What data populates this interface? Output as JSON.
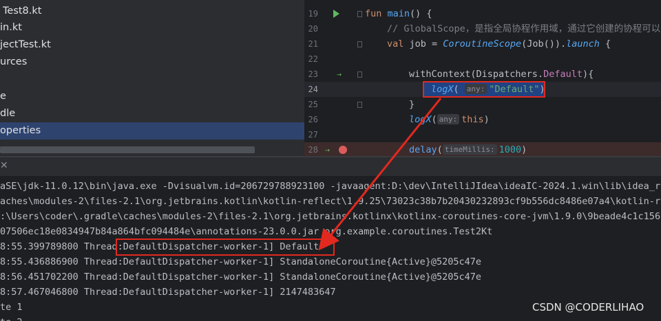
{
  "project_tree": {
    "items": [
      {
        "label": "Test8.kt",
        "selected": false
      },
      {
        "label": "in.kt",
        "selected": false
      },
      {
        "label": "jectTest.kt",
        "selected": false
      },
      {
        "label": "urces",
        "selected": false
      },
      {
        "label": "e",
        "selected": false
      },
      {
        "label": "dle",
        "selected": false
      },
      {
        "label": "operties",
        "selected": true
      }
    ]
  },
  "editor": {
    "lines": [
      {
        "num": "19"
      },
      {
        "num": "20"
      },
      {
        "num": "21"
      },
      {
        "num": "22"
      },
      {
        "num": "23"
      },
      {
        "num": "24"
      },
      {
        "num": "25"
      },
      {
        "num": "26"
      },
      {
        "num": "27"
      },
      {
        "num": "28"
      }
    ],
    "code": {
      "l19_kw": "fun",
      "l19_fn": "main",
      "l19_rest": "() {",
      "l20_comment": "// GlobalScope，是指全局协程作用域，通过它创建的协程可以一",
      "l21_kw": "val",
      "l21_a": " job = ",
      "l21_scope": "CoroutineScope",
      "l21_b": "(Job()).",
      "l21_launch": "launch",
      "l21_c": " {",
      "l23_a": "withContext(Dispatchers.",
      "l23_default": "Default",
      "l23_b": "){",
      "l24_fn": "logX",
      "l24_open": "(",
      "l24_hint": "any:",
      "l24_str": "\"Default\"",
      "l24_close": ")",
      "l25": "}",
      "l26_fn": "logX",
      "l26_open": "(",
      "l26_hint": "any:",
      "l26_this": "this",
      "l26_close": ")",
      "l28_fn": "delay",
      "l28_open": "(",
      "l28_hint": "timeMillis:",
      "l28_num": "1000",
      "l28_close": ")"
    }
  },
  "console": {
    "close_label": "✕",
    "lines": [
      "aSE\\jdk-11.0.12\\bin\\java.exe -Dvisualvm.id=206729788923100 -javaagent:D:\\dev\\IntelliJIdea\\ideaIC-2024.1.win\\lib\\idea_rt.",
      "aches\\modules-2\\files-2.1\\org.jetbrains.kotlin\\kotlin-reflect\\1.9.25\\73023c38b7b20430232893cf9b556dc8486e07a4\\kotlin-ref",
      ":\\Users\\coder\\.gradle\\caches\\modules-2\\files-2.1\\org.jetbrains.kotlinx\\kotlinx-coroutines-core-jvm\\1.9.0\\9beade4c1c1569e",
      "07506ec18e0834947b84a864bfc094484e\\annotations-23.0.0.jar org.example.coroutines.Test2Kt",
      "8:55.399789800 Thread:DefaultDispatcher-worker-1] Default",
      "8:55.436886900 Thread:DefaultDispatcher-worker-1] StandaloneCoroutine{Active}@5205c47e",
      "8:56.451702200 Thread:DefaultDispatcher-worker-1] StandaloneCoroutine{Active}@5205c47e",
      "8:57.467046800 Thread:DefaultDispatcher-worker-1] 2147483647",
      "te 1",
      "te 2"
    ]
  },
  "watermark": "CSDN @CODERLIHAO",
  "colors": {
    "highlight_box": "#e2291f",
    "selection_bg": "#214283",
    "tree_selected": "#2e436e"
  },
  "icons": {
    "run": "run-gutter-icon",
    "breakpoint": "breakpoint-icon",
    "step": "step-into-icon",
    "close": "close-icon"
  }
}
